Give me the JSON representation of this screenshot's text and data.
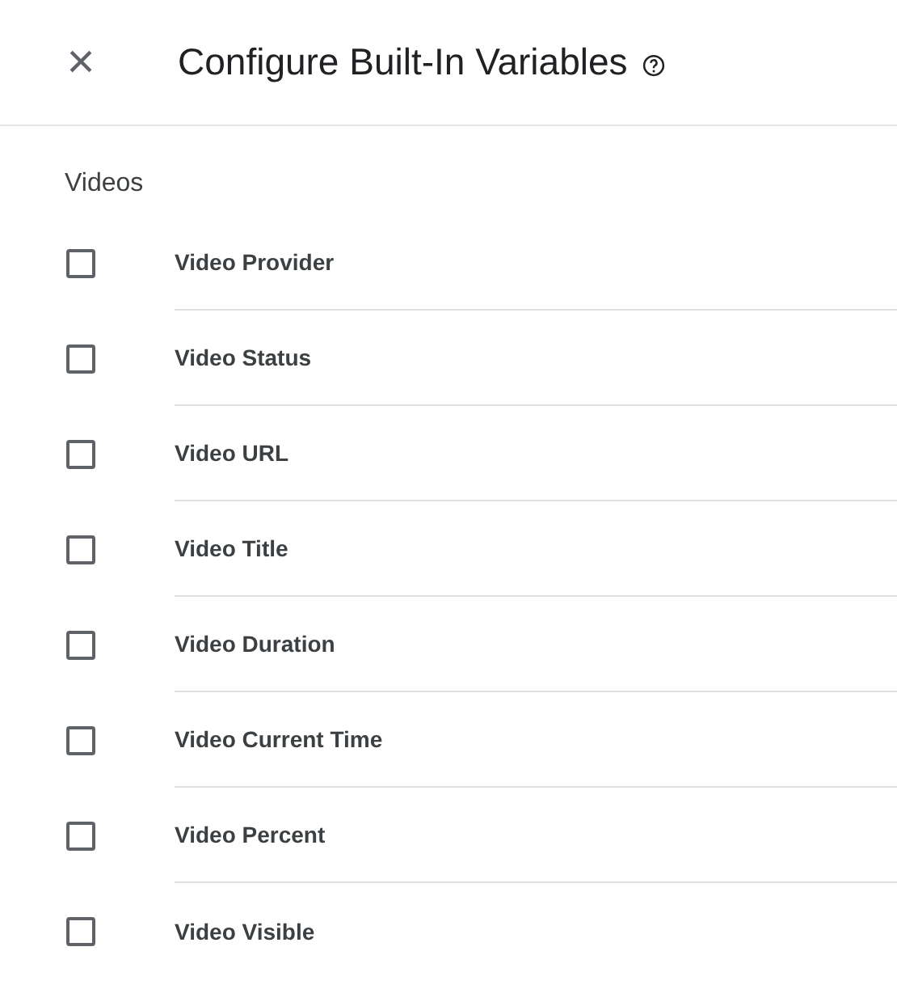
{
  "header": {
    "close_icon": "×",
    "title": "Configure Built-In Variables"
  },
  "section": {
    "title": "Videos"
  },
  "variables": [
    {
      "label": "Video Provider",
      "checked": false
    },
    {
      "label": "Video Status",
      "checked": false
    },
    {
      "label": "Video URL",
      "checked": false
    },
    {
      "label": "Video Title",
      "checked": false
    },
    {
      "label": "Video Duration",
      "checked": false
    },
    {
      "label": "Video Current Time",
      "checked": false
    },
    {
      "label": "Video Percent",
      "checked": false
    },
    {
      "label": "Video Visible",
      "checked": false
    }
  ]
}
